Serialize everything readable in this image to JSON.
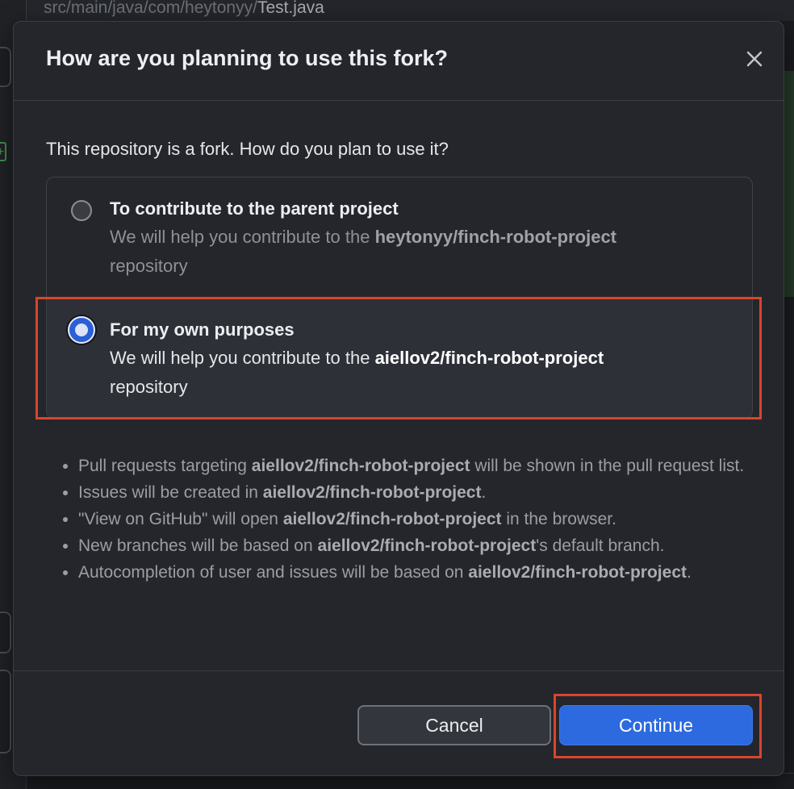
{
  "background": {
    "file_path_prefix": "src/main/java/com/heytonyy/",
    "file_path_name": "Test.java"
  },
  "dialog": {
    "title": "How are you planning to use this fork?",
    "close_icon": "close-icon",
    "prompt": "This repository is a fork. How do you plan to use it?",
    "options": [
      {
        "title": "To contribute to the parent project",
        "desc_prefix": "We will help you contribute to the ",
        "repo": "heytonyy/finch-robot-project",
        "desc_suffix": " repository",
        "selected": false
      },
      {
        "title": "For my own purposes",
        "desc_prefix": "We will help you contribute to the ",
        "repo": "aiellov2/finch-robot-project",
        "desc_suffix": " repository",
        "selected": true
      }
    ],
    "bullets": [
      {
        "pre": "Pull requests targeting ",
        "bold": "aiellov2/finch-robot-project",
        "post": " will be shown in the pull request list."
      },
      {
        "pre": "Issues will be created in ",
        "bold": "aiellov2/finch-robot-project",
        "post": "."
      },
      {
        "pre": "\"View on GitHub\" will open ",
        "bold": "aiellov2/finch-robot-project",
        "post": " in the browser."
      },
      {
        "pre": "New branches will be based on ",
        "bold": "aiellov2/finch-robot-project",
        "post": "'s default branch."
      },
      {
        "pre": "Autocompletion of user and issues will be based on ",
        "bold": "aiellov2/finch-robot-project",
        "post": "."
      }
    ],
    "buttons": {
      "cancel": "Cancel",
      "continue": "Continue"
    }
  },
  "colors": {
    "primary": "#2d6ae0",
    "highlight": "#d9452c",
    "dialog_bg": "#24262b"
  }
}
